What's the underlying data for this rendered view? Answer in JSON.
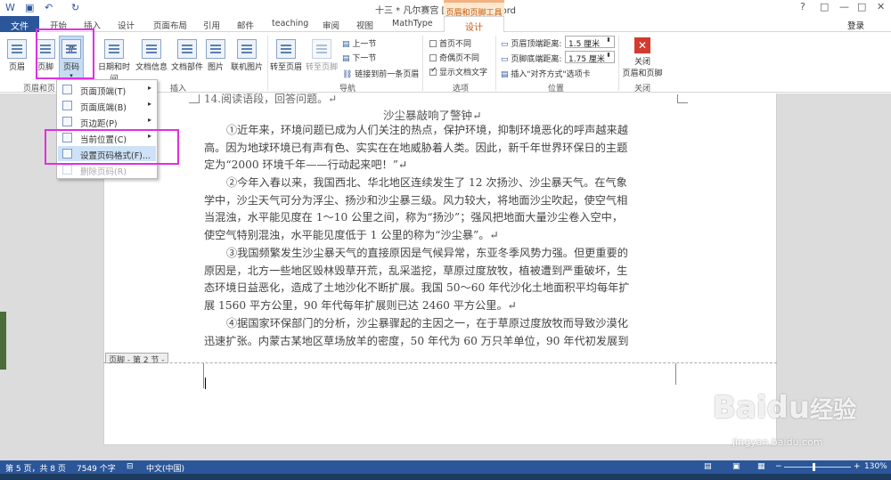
{
  "window": {
    "title": "十三 * 凡尔赛宫 [兼容模式] - Word",
    "controls": [
      "?",
      "□",
      "—",
      "□",
      "✕"
    ]
  },
  "tabs": {
    "file": "文件",
    "items": [
      "开始",
      "插入",
      "设计",
      "页面布局",
      "引用",
      "邮件",
      "teaching",
      "审阅",
      "视图",
      "MathType"
    ],
    "context_group": "页眉和页脚工具",
    "context_tab": "设计",
    "login": "登录"
  },
  "ribbon": {
    "header_footer": {
      "header": "页眉",
      "footer": "页脚",
      "page_number": "页码",
      "group": "页眉和页"
    },
    "insert": {
      "datetime": "日期和时间",
      "docinfo": "文档信息",
      "docparts": "文档部件",
      "picture": "图片",
      "online_picture": "联机图片",
      "group": "插入"
    },
    "navigation": {
      "goto_header": "转至页眉",
      "goto_footer": "转至页脚",
      "prev": "上一节",
      "next": "下一节",
      "link_prev": "链接到前一条页眉",
      "group": "导航"
    },
    "options": {
      "different_first": "首页不同",
      "odd_even": "奇偶页不同",
      "show_text": "显示文档文字",
      "group": "选项"
    },
    "position": {
      "header_from_top_label": "页眉顶端距离:",
      "header_from_top_value": "1.5 厘米",
      "footer_from_bottom_label": "页脚底端距离:",
      "footer_from_bottom_value": "1.75 厘米",
      "insert_align_tab": "插入\"对齐方式\"选项卡",
      "group": "位置"
    },
    "close": {
      "label_line1": "关闭",
      "label_line2": "页眉和页脚",
      "group": "关闭"
    }
  },
  "menu": {
    "items": [
      {
        "label": "页面顶端(T)",
        "arrow": "▸"
      },
      {
        "label": "页面底端(B)",
        "arrow": "▸"
      },
      {
        "label": "页边距(P)",
        "arrow": "▸"
      },
      {
        "label": "当前位置(C)",
        "arrow": "▸"
      },
      {
        "label": "设置页码格式(F)..."
      },
      {
        "label": "删除页码(R)"
      }
    ]
  },
  "document": {
    "top_line": "14.阅读语段，回答问题。↵",
    "heading": "沙尘暴敲响了警钟↵",
    "paragraphs": [
      [
        "①近年来，环境问题已成为人们关注的热点，保护环境，抑制环境恶化的呼声越来越",
        "高。因为地球环境已有声有色、实实在在地威胁着人类。因此，新千年世界环保日的主题",
        "定为“2000 环境千年——行动起来吧！”↵"
      ],
      [
        "②今年入春以来，我国西北、华北地区连续发生了 12 次扬沙、沙尘暴天气。在气象",
        "学中，沙尘天气可分为浮尘、扬沙和沙尘暴三级。风力较大，将地面沙尘吹起，使空气相",
        "当混浊，水平能见度在 1～10 公里之间，称为“扬沙”；强风把地面大量沙尘卷入空中，",
        "使空气特别混浊，水平能见度低于 1 公里的称为“沙尘暴”。↵"
      ],
      [
        "③我国频繁发生沙尘暴天气的直接原因是气候异常，东亚冬季风势力强。但更重要的",
        "原因是，北方一些地区毁林毁草开荒，乱采滥挖，草原过度放牧，植被遭到严重破坏，生",
        "态环境日益恶化，造成了土地沙化不断扩展。我国 50～60 年代沙化土地面积平均每年扩",
        "展 1560 平方公里，90 年代每年扩展则已达 2460 平方公里。↵"
      ],
      [
        "④据国家环保部门的分析，沙尘暴骤起的主因之一，在于草原过度放牧而导致沙漠化",
        "迅速扩张。内蒙古某地区草场放羊的密度，50 年代为 60 万只羊单位，90 年代初发展到"
      ]
    ],
    "footer_tag": "页脚 - 第 2 节 -"
  },
  "status": {
    "page": "第 5 页，共 8 页",
    "words": "7549 个字",
    "lang": "中文(中国)",
    "zoom": "130%"
  },
  "watermark": {
    "brand": "Baidu",
    "cn": "经验",
    "url": "jingyan.baidu.com"
  }
}
